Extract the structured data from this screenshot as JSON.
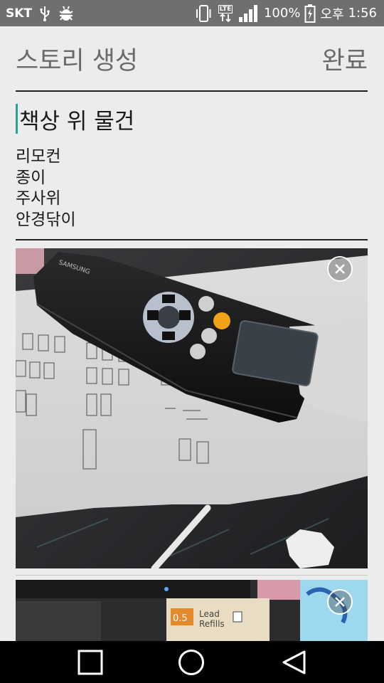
{
  "status_bar": {
    "carrier": "SKT",
    "battery_text": "100%",
    "ampm": "오후",
    "time": "1:56",
    "network_label": "LTE",
    "icons": [
      "usb-icon",
      "bug-icon",
      "vibrate-icon",
      "lte-icon",
      "signal-icon",
      "battery-charging-icon"
    ]
  },
  "header": {
    "title": "스토리 생성",
    "done_label": "완료"
  },
  "story": {
    "title": "책상 위 물건",
    "body_lines": [
      "리모컨",
      "종이",
      "주사위",
      "안경닦이"
    ]
  },
  "photos": [
    {
      "name": "photo-remote-on-paper",
      "close_icon": "close-icon"
    },
    {
      "name": "photo-lead-refills",
      "close_icon": "close-icon"
    }
  ],
  "photo2_labels": {
    "lead_size": "0.5",
    "lead_word": "Lead",
    "refills_word": "Refills"
  },
  "remote_brand": "SAMSUNG",
  "nav": {
    "icons": [
      "recents-icon",
      "home-icon",
      "back-icon"
    ]
  },
  "colors": {
    "status_bar": "#6f6f6f",
    "background": "#ececec",
    "accent_caret": "#2aa198",
    "nav_bar": "#000000"
  }
}
